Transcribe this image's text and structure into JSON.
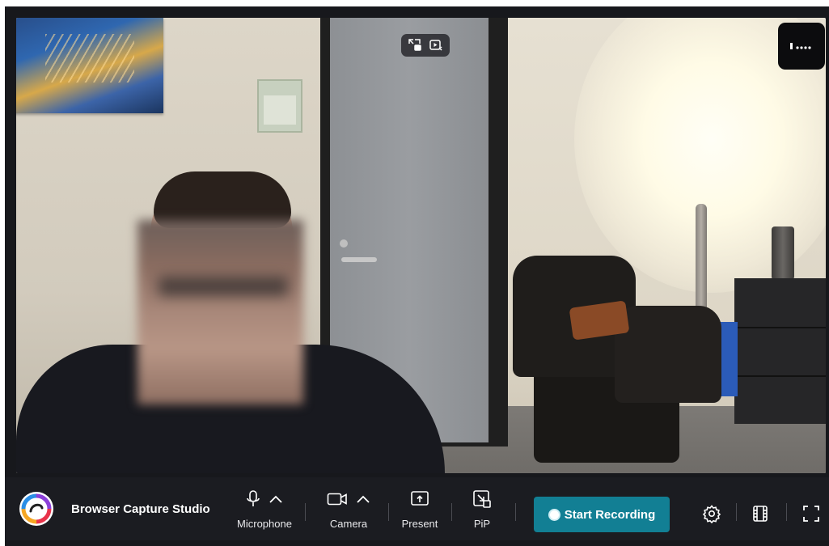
{
  "app": {
    "title": "Browser Capture Studio",
    "accent_color": "#127f94",
    "background_color": "#1b1c21"
  },
  "preview": {
    "overlay_icons": [
      "swap-layout-icon",
      "preview-play-icon"
    ],
    "grip_icon": "drag-handle-icon",
    "face_blurred": true
  },
  "toolbar": {
    "microphone": {
      "label": "Microphone",
      "icon": "microphone-icon",
      "expand_icon": "chevron-up-icon"
    },
    "camera": {
      "label": "Camera",
      "icon": "video-camera-icon",
      "expand_icon": "chevron-up-icon"
    },
    "present": {
      "label": "Present",
      "icon": "screen-share-icon"
    },
    "pip": {
      "label": "PiP",
      "icon": "picture-in-picture-icon"
    },
    "record": {
      "label": "Start Recording",
      "icon": "record-dot-icon"
    },
    "right_icons": [
      "gear-icon",
      "filmstrip-icon",
      "fullscreen-icon"
    ]
  }
}
